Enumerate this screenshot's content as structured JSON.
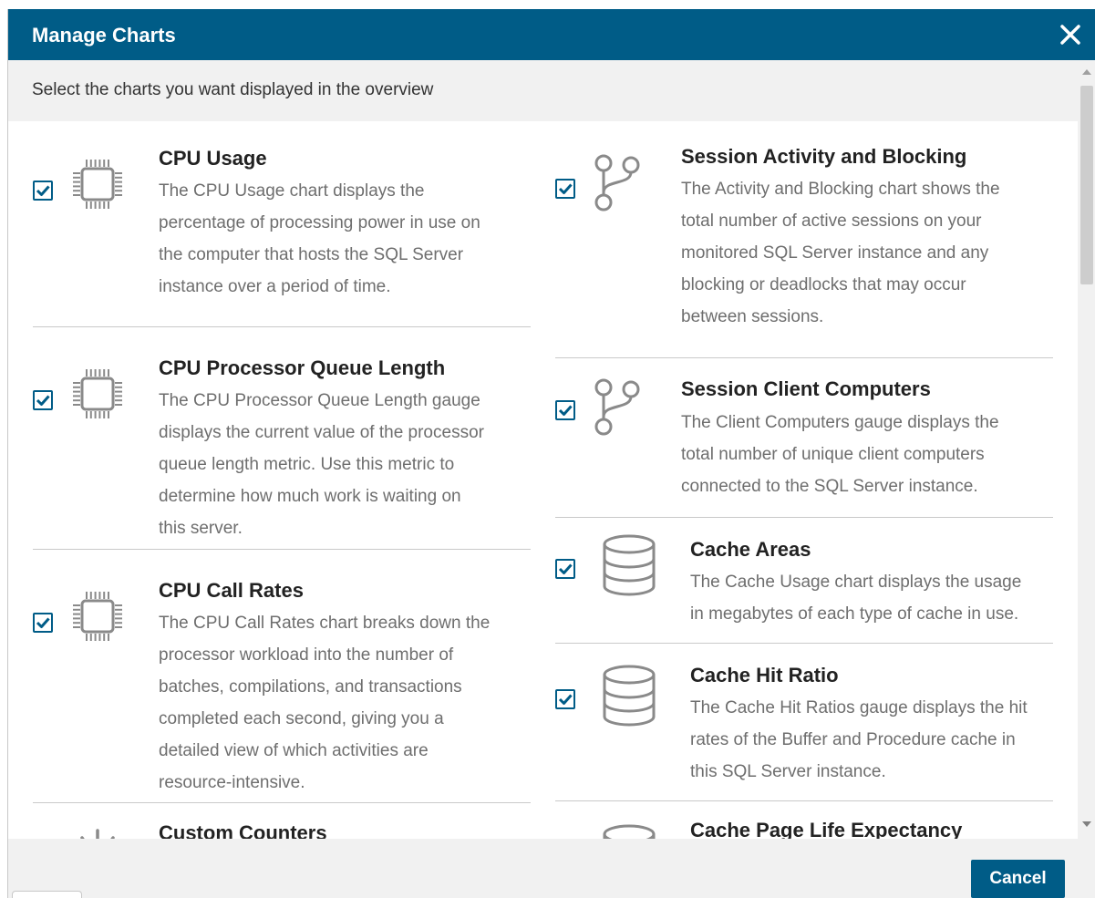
{
  "dialog": {
    "title": "Manage Charts",
    "subtitle": "Select the charts you want displayed in the overview",
    "cancel_label": "Cancel"
  },
  "left_items": [
    {
      "title": "CPU Usage",
      "icon": "cpu-chip-icon",
      "checked": true,
      "desc": [
        "The CPU Usage chart displays the",
        "percentage of processing power in use on",
        "the computer that hosts the SQL Server",
        "instance over a period of time."
      ]
    },
    {
      "title": "CPU Processor Queue Length",
      "icon": "cpu-chip-icon",
      "checked": true,
      "desc": [
        "The CPU Processor Queue Length gauge",
        "displays the current value of the processor",
        "queue length metric. Use this metric to",
        "determine how much work is waiting on",
        "this server."
      ]
    },
    {
      "title": "CPU Call Rates",
      "icon": "cpu-chip-icon",
      "checked": true,
      "desc": [
        "The CPU Call Rates chart breaks down the",
        "processor workload into the number of",
        "batches, compilations, and transactions",
        "completed each second, giving you a",
        "detailed view of which activities are",
        "resource-intensive."
      ]
    },
    {
      "title": "Custom Counters",
      "icon": "spinner-icon",
      "checked": false,
      "desc": []
    }
  ],
  "right_items": [
    {
      "title": "Session Activity and Blocking",
      "icon": "branch-icon",
      "checked": true,
      "desc": [
        "The Activity and Blocking chart shows the",
        "total number of active sessions on your",
        "monitored SQL Server instance and any",
        "blocking or deadlocks that may occur",
        "between sessions."
      ]
    },
    {
      "title": "Session Client Computers",
      "icon": "branch-icon",
      "checked": true,
      "desc": [
        "The Client Computers gauge displays the",
        "total number of unique client computers",
        "connected to the SQL Server instance."
      ]
    },
    {
      "title": "Cache Areas",
      "icon": "database-icon",
      "checked": true,
      "desc": [
        "The Cache Usage chart displays the usage",
        "in megabytes of each type of cache in use."
      ]
    },
    {
      "title": "Cache Hit Ratio",
      "icon": "database-icon",
      "checked": true,
      "desc": [
        "The Cache Hit Ratios gauge displays the hit",
        "rates of the Buffer and Procedure cache in",
        "this SQL Server instance."
      ]
    },
    {
      "title": "Cache Page Life Expectancy",
      "icon": "database-icon",
      "checked": true,
      "desc": []
    }
  ],
  "colors": {
    "brand": "#005c87",
    "description_text": "#6e6e6e"
  }
}
